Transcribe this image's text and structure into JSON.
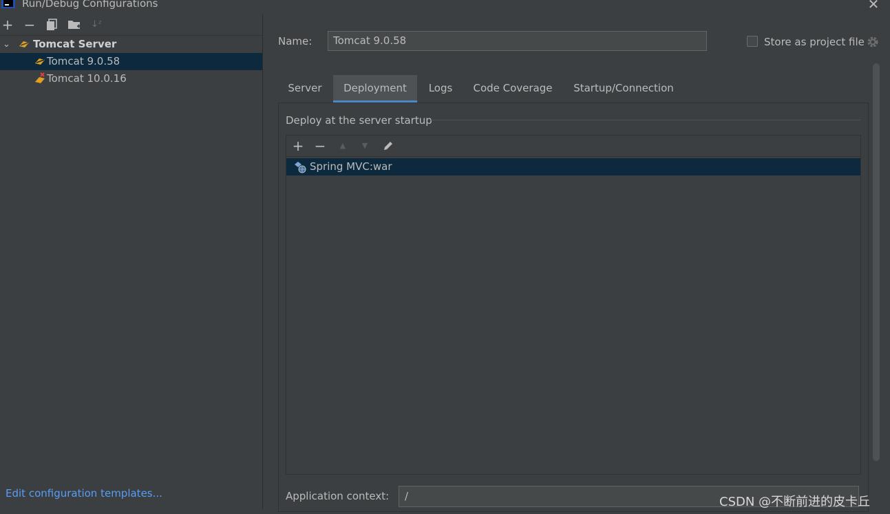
{
  "window": {
    "title": "Run/Debug Configurations"
  },
  "left_toolbar": {
    "add": "+",
    "remove": "−",
    "copy": "⧉",
    "folder": "▆",
    "sort": "↓ᶻ"
  },
  "tree": {
    "group_label": "Tomcat Server",
    "items": [
      {
        "label": "Tomcat 9.0.58",
        "selected": true
      },
      {
        "label": "Tomcat 10.0.16",
        "selected": false
      }
    ]
  },
  "edit_templates_link": "Edit configuration templates...",
  "name": {
    "label": "Name:",
    "value": "Tomcat 9.0.58"
  },
  "store_as_project_file": {
    "label": "Store as project file",
    "checked": false
  },
  "tabs": [
    {
      "label": "Server",
      "active": false
    },
    {
      "label": "Deployment",
      "active": true
    },
    {
      "label": "Logs",
      "active": false
    },
    {
      "label": "Code Coverage",
      "active": false
    },
    {
      "label": "Startup/Connection",
      "active": false
    }
  ],
  "deployment": {
    "section_label": "Deploy at the server startup",
    "toolbar": {
      "add": "+",
      "remove": "−",
      "up": "▲",
      "down": "▼"
    },
    "artifacts": [
      {
        "label": "Spring MVC:war",
        "selected": true
      }
    ]
  },
  "application_context": {
    "label": "Application context:",
    "value": "/"
  },
  "watermark": "CSDN @不断前进的皮卡丘",
  "colors": {
    "background": "#3c3f41",
    "selection": "#0d293e",
    "accent_tab": "#4a88c7",
    "link": "#589df6"
  }
}
